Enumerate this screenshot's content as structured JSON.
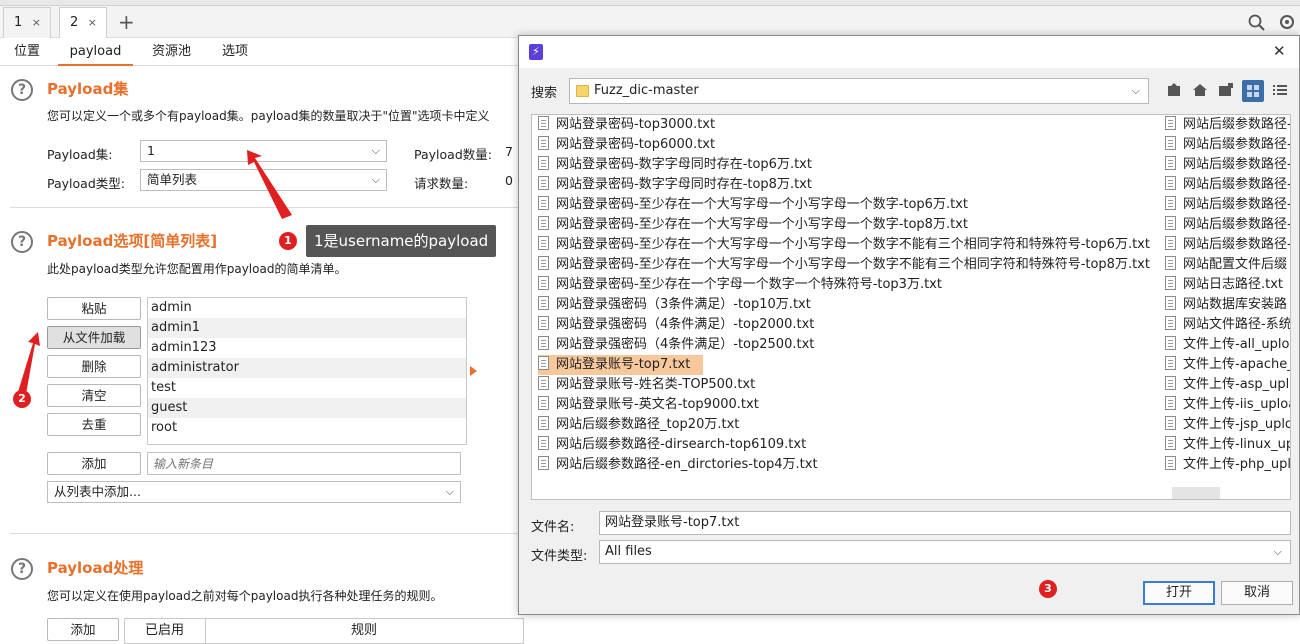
{
  "tabs": [
    {
      "label": "1",
      "close": "×"
    },
    {
      "label": "2",
      "close": "×"
    }
  ],
  "add_tab": "+",
  "subtabs": [
    "位置",
    "payload",
    "资源池",
    "选项"
  ],
  "payload_sets": {
    "title": "Payload集",
    "desc": "您可以定义一个或多个有payload集。payload集的数量取决于\"位置\"选项卡中定义",
    "set_label": "Payload集:",
    "set_value": "1",
    "type_label": "Payload类型:",
    "type_value": "简单列表",
    "count_label": "Payload数量:",
    "count_value": "7",
    "req_label": "请求数量:",
    "req_value": "0"
  },
  "payload_options": {
    "title": "Payload选项[简单列表]",
    "desc": "此处payload类型允许您配置用作payload的简单清单。",
    "buttons": [
      "粘贴",
      "从文件加载",
      "删除",
      "清空",
      "去重"
    ],
    "items": [
      "admin",
      "admin1",
      "admin123",
      "administrator",
      "test",
      "guest",
      "root"
    ],
    "add_button": "添加",
    "add_placeholder": "输入新条目",
    "add_from_list": "从列表中添加..."
  },
  "payload_processing": {
    "title": "Payload处理",
    "desc": "您可以定义在使用payload之前对每个payload执行各种处理任务的规则。",
    "add_button": "添加",
    "col_enabled": "已启用",
    "col_rule": "规则"
  },
  "annotations": {
    "badge1": "1",
    "tooltip1": "1是username的payload",
    "badge2": "2",
    "badge3": "3"
  },
  "dialog": {
    "icon": "⚡",
    "close": "✕",
    "search_label": "搜索",
    "folder": "Fuzz_dic-master",
    "files_left": [
      "网站登录密码-top3000.txt",
      "网站登录密码-top6000.txt",
      "网站登录密码-数字字母同时存在-top6万.txt",
      "网站登录密码-数字字母同时存在-top8万.txt",
      "网站登录密码-至少存在一个大写字母一个小写字母一个数字-top6万.txt",
      "网站登录密码-至少存在一个大写字母一个小写字母一个数字-top8万.txt",
      "网站登录密码-至少存在一个大写字母一个小写字母一个数字不能有三个相同字符和特殊符号-top6万.txt",
      "网站登录密码-至少存在一个大写字母一个小写字母一个数字不能有三个相同字符和特殊符号-top8万.txt",
      "网站登录密码-至少存在一个字母一个数字一个特殊符号-top3万.txt",
      "网站登录强密码（3条件满足）-top10万.txt",
      "网站登录强密码（4条件满足）-top2000.txt",
      "网站登录强密码（4条件满足）-top2500.txt",
      "网站登录账号-top7.txt",
      "网站登录账号-姓名类-TOP500.txt",
      "网站登录账号-英文名-top9000.txt",
      "网站后缀参数路径_top20万.txt",
      "网站后缀参数路径-dirsearch-top6109.txt",
      "网站后缀参数路径-en_dirctories-top4万.txt"
    ],
    "selected_index": 12,
    "files_right": [
      "网站后缀参数路径-",
      "网站后缀参数路径-",
      "网站后缀参数路径-",
      "网站后缀参数路径-",
      "网站后缀参数路径-",
      "网站后缀参数路径-",
      "网站后缀参数路径-",
      "网站配置文件后缀",
      "网站日志路径.txt",
      "网站数据库安装路",
      "网站文件路径-系统",
      "文件上传-all_uploa",
      "文件上传-apache_",
      "文件上传-asp_uplo",
      "文件上传-iis_uploa",
      "文件上传-jsp_uplo",
      "文件上传-linux_up",
      "文件上传-php_uplo"
    ],
    "filename_label": "文件名:",
    "filename_value": "网站登录账号-top7.txt",
    "filetype_label": "文件类型:",
    "filetype_value": "All files",
    "open_button": "打开",
    "cancel_button": "取消"
  },
  "colors": {
    "accent": "#e8702a",
    "badge": "#e02020",
    "selected": "#f8c89d"
  }
}
